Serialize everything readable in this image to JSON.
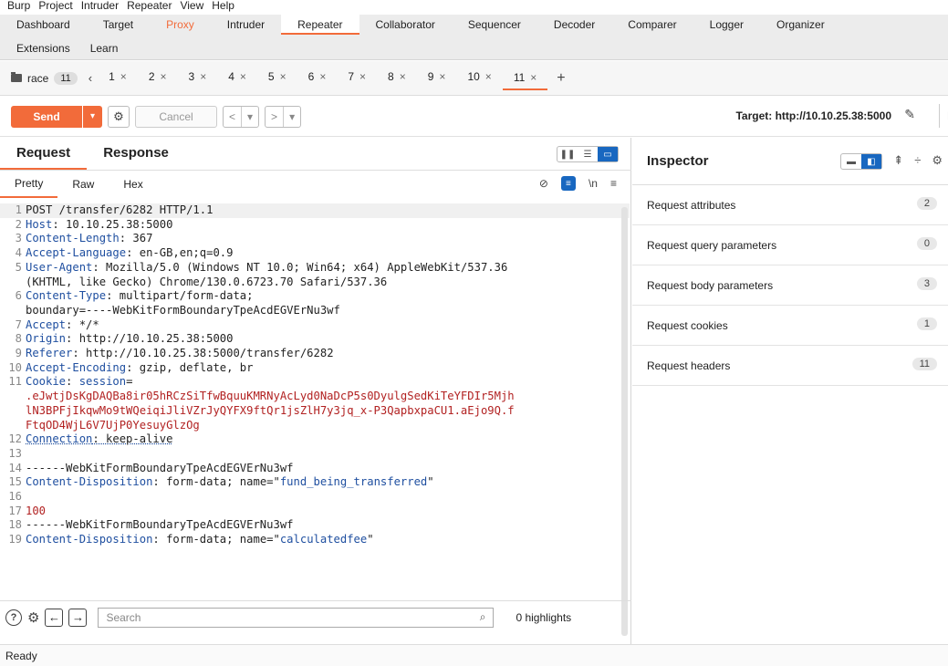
{
  "menu": [
    "Burp",
    "Project",
    "Intruder",
    "Repeater",
    "View",
    "Help"
  ],
  "top_tabs_row1": [
    "Dashboard",
    "Target",
    "Proxy",
    "Intruder",
    "Repeater",
    "Collaborator",
    "Sequencer",
    "Decoder",
    "Comparer",
    "Logger",
    "Organizer"
  ],
  "top_tabs_row2": [
    "Extensions",
    "Learn"
  ],
  "repeater": {
    "group_name": "race",
    "group_count": "11",
    "tabs": [
      "1",
      "2",
      "3",
      "4",
      "5",
      "6",
      "7",
      "8",
      "9",
      "10",
      "11"
    ],
    "active_tab": "11",
    "close_glyph": "×",
    "prev_glyph": "‹",
    "add_glyph": "+"
  },
  "toolbar": {
    "send_label": "Send",
    "cancel_label": "Cancel",
    "target_label": "Target: http://10.10.25.38:5000",
    "truncated_label": "H"
  },
  "panel": {
    "request_tab": "Request",
    "response_tab": "Response",
    "subtabs": [
      "Pretty",
      "Raw",
      "Hex"
    ],
    "newline_label": "\\n"
  },
  "request_lines": [
    {
      "n": "1",
      "parts": [
        {
          "t": "POST /transfer/6282 HTTP/1.1",
          "c": ""
        }
      ]
    },
    {
      "n": "2",
      "parts": [
        {
          "t": "Host",
          "c": "hname"
        },
        {
          "t": ": 10.10.25.38:5000",
          "c": ""
        }
      ]
    },
    {
      "n": "3",
      "parts": [
        {
          "t": "Content-Length",
          "c": "hname"
        },
        {
          "t": ": 367",
          "c": ""
        }
      ]
    },
    {
      "n": "4",
      "parts": [
        {
          "t": "Accept-Language",
          "c": "hname"
        },
        {
          "t": ": en-GB,en;q=0.9",
          "c": ""
        }
      ]
    },
    {
      "n": "5",
      "parts": [
        {
          "t": "User-Agent",
          "c": "hname"
        },
        {
          "t": ": Mozilla/5.0 (Windows NT 10.0; Win64; x64) AppleWebKit/537.36",
          "c": ""
        }
      ]
    },
    {
      "n": "",
      "parts": [
        {
          "t": "(KHTML, like Gecko) Chrome/130.0.6723.70 Safari/537.36",
          "c": ""
        }
      ]
    },
    {
      "n": "6",
      "parts": [
        {
          "t": "Content-Type",
          "c": "hname"
        },
        {
          "t": ": multipart/form-data;",
          "c": ""
        }
      ]
    },
    {
      "n": "",
      "parts": [
        {
          "t": "boundary=----WebKitFormBoundaryTpeAcdEGVErNu3wf",
          "c": ""
        }
      ]
    },
    {
      "n": "7",
      "parts": [
        {
          "t": "Accept",
          "c": "hname"
        },
        {
          "t": ": */*",
          "c": ""
        }
      ]
    },
    {
      "n": "8",
      "parts": [
        {
          "t": "Origin",
          "c": "hname"
        },
        {
          "t": ": http://10.10.25.38:5000",
          "c": ""
        }
      ]
    },
    {
      "n": "9",
      "parts": [
        {
          "t": "Referer",
          "c": "hname"
        },
        {
          "t": ": http://10.10.25.38:5000/transfer/6282",
          "c": ""
        }
      ]
    },
    {
      "n": "10",
      "parts": [
        {
          "t": "Accept-Encoding",
          "c": "hname"
        },
        {
          "t": ": gzip, deflate, br",
          "c": ""
        }
      ]
    },
    {
      "n": "11",
      "parts": [
        {
          "t": "Cookie",
          "c": "hname"
        },
        {
          "t": ": ",
          "c": ""
        },
        {
          "t": "session",
          "c": "hname"
        },
        {
          "t": "=",
          "c": ""
        }
      ]
    },
    {
      "n": "",
      "parts": [
        {
          "t": ".eJwtjDsKgDAQBa8ir05hRCzSiTfwBquuKMRNyAcLyd0NaDcP5s0DyulgSedKiTeYFDIr5Mjh",
          "c": "cookie"
        }
      ]
    },
    {
      "n": "",
      "parts": [
        {
          "t": "lN3BPFjIkqwMo9tWQeiqiJliVZrJyQYFX9ftQr1jsZlH7y3jq_x-P3QapbxpaCU1.aEjo9Q.f",
          "c": "cookie"
        }
      ]
    },
    {
      "n": "",
      "parts": [
        {
          "t": "FtqOD4WjL6V7UjP0YesuyGlzOg",
          "c": "cookie"
        }
      ]
    },
    {
      "n": "12",
      "parts": [
        {
          "t": "Connection",
          "c": "hname conn"
        },
        {
          "t": ": keep-alive",
          "c": "conn"
        }
      ]
    },
    {
      "n": "13",
      "parts": [
        {
          "t": "",
          "c": ""
        }
      ]
    },
    {
      "n": "14",
      "parts": [
        {
          "t": "------WebKitFormBoundaryTpeAcdEGVErNu3wf",
          "c": ""
        }
      ]
    },
    {
      "n": "15",
      "parts": [
        {
          "t": "Content-Disposition",
          "c": "hname"
        },
        {
          "t": ": form-data; name=\"",
          "c": ""
        },
        {
          "t": "fund_being_transferred",
          "c": "strq"
        },
        {
          "t": "\"",
          "c": ""
        }
      ]
    },
    {
      "n": "16",
      "parts": [
        {
          "t": "",
          "c": ""
        }
      ]
    },
    {
      "n": "17",
      "parts": [
        {
          "t": "100",
          "c": "num"
        }
      ]
    },
    {
      "n": "18",
      "parts": [
        {
          "t": "------WebKitFormBoundaryTpeAcdEGVErNu3wf",
          "c": ""
        }
      ]
    },
    {
      "n": "19",
      "parts": [
        {
          "t": "Content-Disposition",
          "c": "hname"
        },
        {
          "t": ": form-data; name=\"",
          "c": ""
        },
        {
          "t": "calculatedfee",
          "c": "strq"
        },
        {
          "t": "\"",
          "c": ""
        }
      ]
    }
  ],
  "search": {
    "placeholder": "Search",
    "highlights": "0 highlights"
  },
  "inspector": {
    "title": "Inspector",
    "rows": [
      {
        "label": "Request attributes",
        "count": "2"
      },
      {
        "label": "Request query parameters",
        "count": "0"
      },
      {
        "label": "Request body parameters",
        "count": "3"
      },
      {
        "label": "Request cookies",
        "count": "1"
      },
      {
        "label": "Request headers",
        "count": "11"
      }
    ]
  },
  "status": "Ready",
  "colors": {
    "accent": "#f26b3a",
    "blue": "#1867c0"
  }
}
